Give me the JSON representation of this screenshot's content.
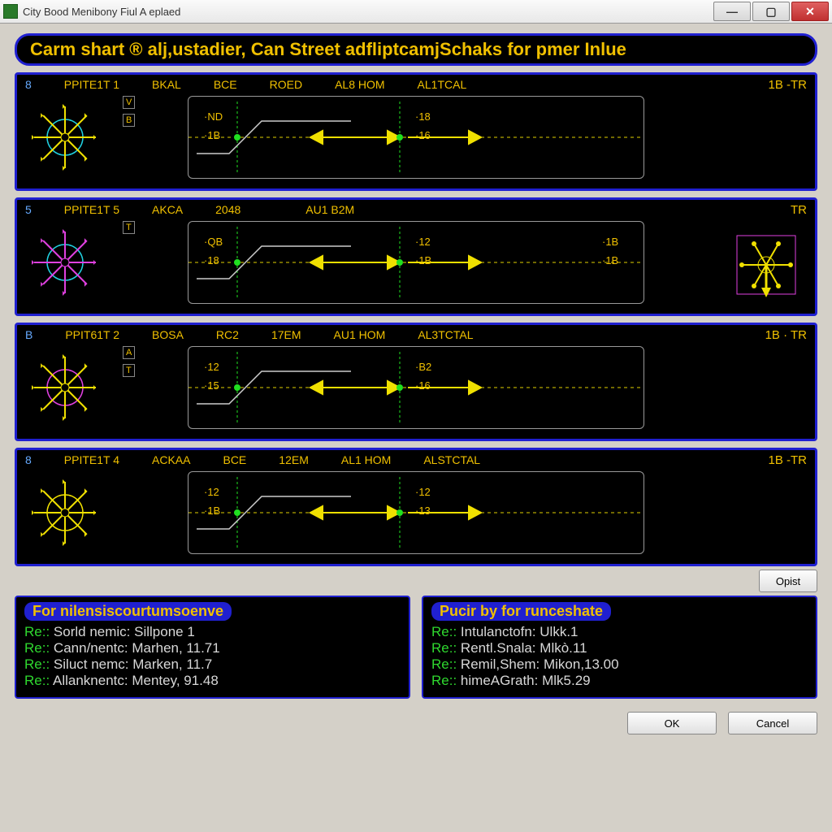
{
  "window": {
    "title": "City Bood Menibony Fiul A eplaed"
  },
  "banner": "Carm shart ® alj,ustadier, Can Street adfliptcamjSchaks for pmer Inlue",
  "panels": [
    {
      "id": "8",
      "name": "PPITE1T 1",
      "cols": [
        "BKAL",
        "BCE",
        "ROED",
        "AL8 HOM",
        "AL1TCAL"
      ],
      "side": "1B -TR",
      "vlabels": [
        "V",
        "B"
      ],
      "d1": [
        "·ND",
        "·1B"
      ],
      "d2": [
        "·18",
        "·16"
      ]
    },
    {
      "id": "5",
      "name": "PPITE1T 5",
      "cols": [
        "AKCA",
        "2048",
        "",
        "AU1 B2M",
        ""
      ],
      "side": "TR",
      "vlabels": [
        "T"
      ],
      "d1": [
        "·QB",
        "·18"
      ],
      "d2": [
        "·12",
        "·1B"
      ],
      "r": [
        "·1B",
        "·1B"
      ],
      "aux": true
    },
    {
      "id": "B",
      "name": "PPIT61T 2",
      "cols": [
        "BOSA",
        "RC2",
        "17EM",
        "AU1 HOM",
        "AL3TCTAL"
      ],
      "side": "1B · TR",
      "vlabels": [
        "A",
        "T"
      ],
      "d1": [
        "·12",
        "·15"
      ],
      "d2": [
        "·B2",
        "·16"
      ]
    },
    {
      "id": "8",
      "name": "PPITE1T 4",
      "cols": [
        "ACKAA",
        "BCE",
        "12EM",
        "AL1 HOM",
        "ALSTCTAL"
      ],
      "side": "1B -TR",
      "vlabels": [],
      "d1": [
        "·12",
        "·1B"
      ],
      "d2": [
        "·12",
        "·13"
      ]
    }
  ],
  "opist_label": "Opist",
  "left_box": {
    "title": "For nilensiscourtumsoenve",
    "lines": [
      {
        "pfx": "Re::",
        "lbl": "Sorld nemic:",
        "val": "Sillpone 1"
      },
      {
        "pfx": "Re::",
        "lbl": "Cann/nentc:",
        "val": "Marhen, 11.71"
      },
      {
        "pfx": "Re::",
        "lbl": "Siluct nemc:",
        "val": "Marken, 11.7"
      },
      {
        "pfx": "Re::",
        "lbl": "Allanknentc:",
        "val": "Mentey, 91.48"
      }
    ]
  },
  "right_box": {
    "title": "Pucir by for runceshate",
    "lines": [
      {
        "pfx": "Re::",
        "lbl": "Intulanctofn:",
        "val": "Ulkk.1"
      },
      {
        "pfx": "Re::",
        "lbl": "Rentl.Snala:",
        "val": "Mlkò.11"
      },
      {
        "pfx": "Re::",
        "lbl": "Remil,Shem:",
        "val": "Mikon,13.00"
      },
      {
        "pfx": "Re::",
        "lbl": "himeAGrath:",
        "val": "Mlk5.29"
      }
    ]
  },
  "buttons": {
    "ok": "OK",
    "cancel": "Cancel"
  }
}
